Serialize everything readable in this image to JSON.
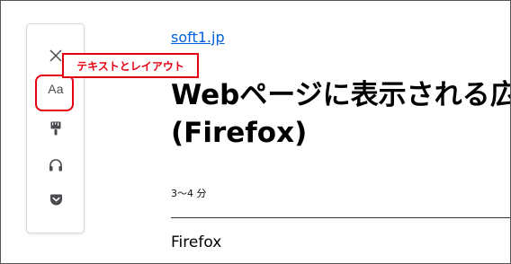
{
  "toolbar": {
    "buttons": [
      {
        "name": "close",
        "icon": "close-icon"
      },
      {
        "name": "type",
        "label": "Aa",
        "icon": "type-controls-icon"
      },
      {
        "name": "theme",
        "icon": "paintbrush-icon"
      },
      {
        "name": "listen",
        "icon": "headphones-icon"
      },
      {
        "name": "pocket",
        "icon": "pocket-icon"
      }
    ],
    "type_label": "Aa"
  },
  "annotation": {
    "tooltip_text": "テキストとレイアウト",
    "color": "#e60012"
  },
  "article": {
    "domain": "soft1.jp",
    "title_line1": "Webページに表示される広",
    "title_line2": "(Firefox)",
    "read_time": "3〜4 分",
    "body_start": "Firefox"
  },
  "colors": {
    "link": "#0060df",
    "icon": "#4a4a4f",
    "highlight": "#e60012"
  }
}
